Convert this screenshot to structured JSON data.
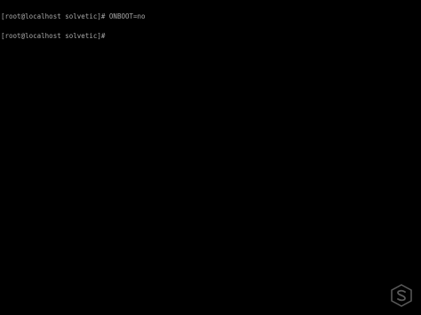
{
  "terminal": {
    "lines": [
      {
        "prompt": "[root@localhost solvetic]#",
        "command": " ONBOOT=no"
      },
      {
        "prompt": "[root@localhost solvetic]#",
        "command": ""
      }
    ]
  },
  "colors": {
    "background": "#000000",
    "text": "#a8a8a8",
    "watermark": "#5a5a5a"
  },
  "watermark": {
    "icon": "solvetic-s-logo-icon"
  }
}
